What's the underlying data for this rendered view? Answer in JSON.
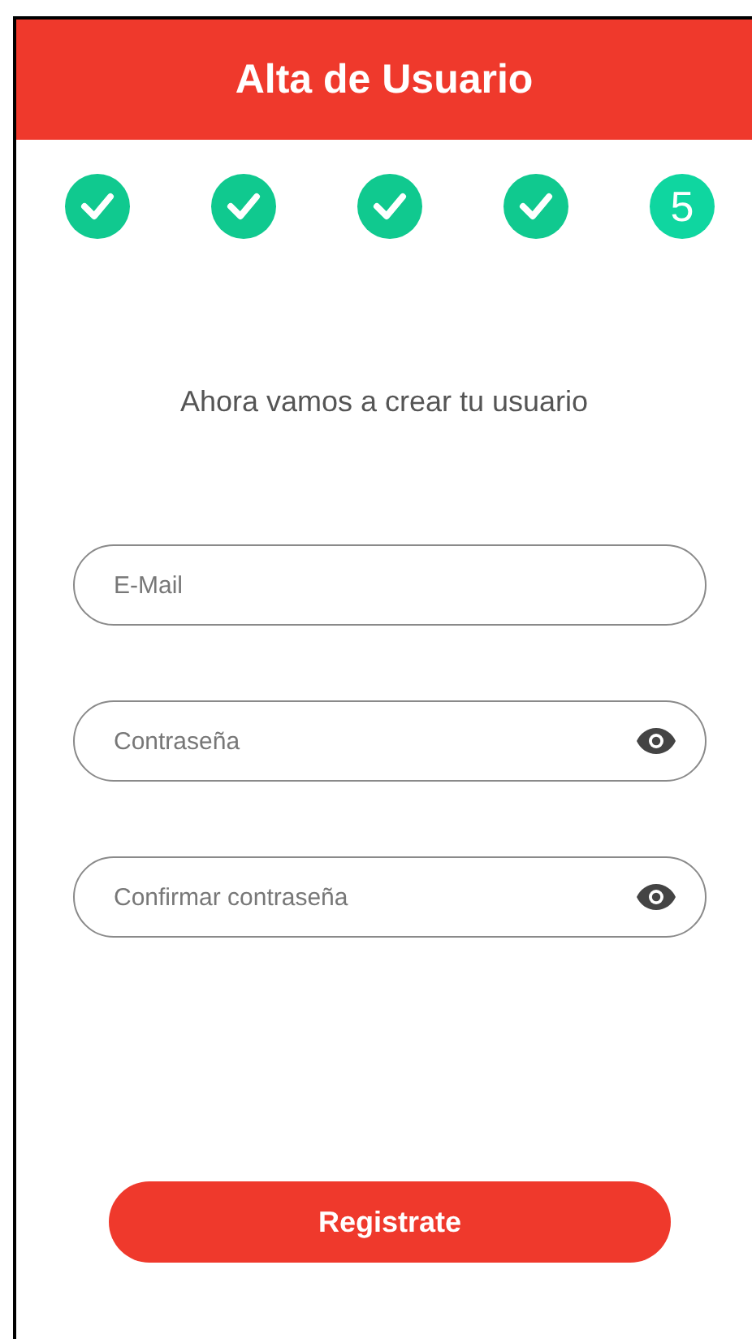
{
  "header": {
    "title": "Alta de Usuario"
  },
  "steps": [
    {
      "completed": true
    },
    {
      "completed": true
    },
    {
      "completed": true
    },
    {
      "completed": true
    },
    {
      "completed": false,
      "label": "5"
    }
  ],
  "subtitle": "Ahora vamos a crear tu usuario",
  "fields": [
    {
      "kind": "email",
      "placeholder": "E-Mail"
    },
    {
      "kind": "password",
      "placeholder": "Contraseña"
    },
    {
      "kind": "password",
      "placeholder": "Confirmar contraseña"
    }
  ],
  "submit_button": "Registrate"
}
